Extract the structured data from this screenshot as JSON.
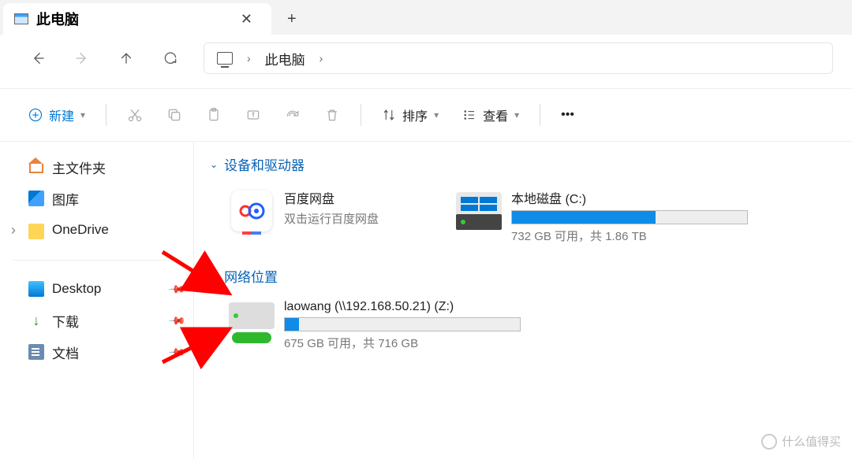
{
  "tab": {
    "title": "此电脑"
  },
  "breadcrumb": {
    "current": "此电脑"
  },
  "toolbar": {
    "new": "新建",
    "sort": "排序",
    "view": "查看"
  },
  "sidebar": {
    "home": "主文件夹",
    "gallery": "图库",
    "onedrive": "OneDrive",
    "desktop": "Desktop",
    "downloads": "下载",
    "documents": "文档"
  },
  "sections": {
    "devices": "设备和驱动器",
    "network": "网络位置"
  },
  "items": {
    "baidu": {
      "name": "百度网盘",
      "sub": "双击运行百度网盘"
    },
    "cdisk": {
      "name": "本地磁盘 (C:)",
      "status": "732 GB 可用，共 1.86 TB",
      "percent": 61
    },
    "zdisk": {
      "name": "laowang (\\\\192.168.50.21) (Z:)",
      "status": "675 GB 可用，共 716 GB",
      "percent": 6
    }
  },
  "watermark": "什么值得买"
}
